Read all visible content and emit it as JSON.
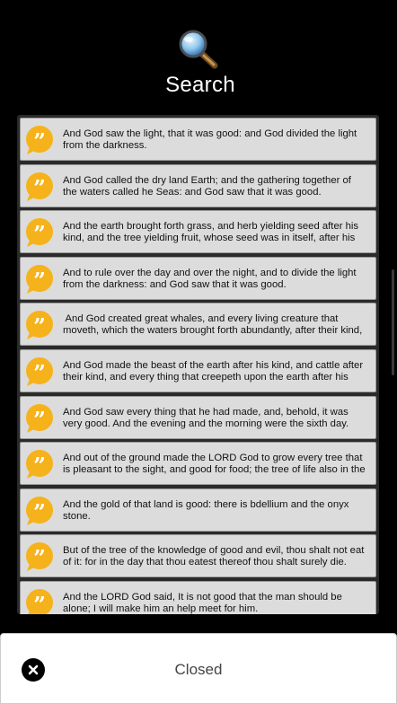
{
  "header": {
    "title": "Search",
    "icon": "magnifier-icon"
  },
  "results": [
    {
      "icon": "quote-bubble-icon",
      "text": "And God saw the light, that it was good: and God divided the light\nfrom the darkness."
    },
    {
      "icon": "quote-bubble-icon",
      "text": "And God called the dry land Earth; and the gathering together of\nthe waters called he Seas: and God saw that it was good."
    },
    {
      "icon": "quote-bubble-icon",
      "text": "And the earth brought forth grass, and herb yielding seed after his\nkind, and the tree yielding fruit, whose seed was in itself, after his"
    },
    {
      "icon": "quote-bubble-icon",
      "text": "And to rule over the day and over the night, and to divide the light\nfrom the darkness: and God saw that it was good."
    },
    {
      "icon": "quote-bubble-icon",
      "text": " And God created great whales, and every living creature that\nmoveth, which the waters brought forth abundantly, after their kind,"
    },
    {
      "icon": "quote-bubble-icon",
      "text": "And God made the beast of the earth after his kind, and cattle after\ntheir kind, and every thing that creepeth upon the earth after his"
    },
    {
      "icon": "quote-bubble-icon",
      "text": "And God saw every thing that he had made, and, behold, it was\nvery good. And the evening and the morning were the sixth day."
    },
    {
      "icon": "quote-bubble-icon",
      "text": "And out of the ground made the LORD God to grow every tree that\nis pleasant to the sight, and good for food; the tree of life also in the"
    },
    {
      "icon": "quote-bubble-icon",
      "text": "And the gold of that land is good: there is bdellium and the onyx\nstone."
    },
    {
      "icon": "quote-bubble-icon",
      "text": "But of the tree of the knowledge of good and evil, thou shalt not eat\nof it: for in the day that thou eatest thereof thou shalt surely die."
    },
    {
      "icon": "quote-bubble-icon",
      "text": "And the LORD God said, It is not good that the man should be\nalone; I will make him an help meet for him."
    }
  ],
  "bottom_bar": {
    "status": "Closed",
    "close_icon": "close-icon"
  },
  "colors": {
    "quote_icon": "#f5b21b",
    "row_bg": "#dcdcdc",
    "background": "#000000"
  }
}
